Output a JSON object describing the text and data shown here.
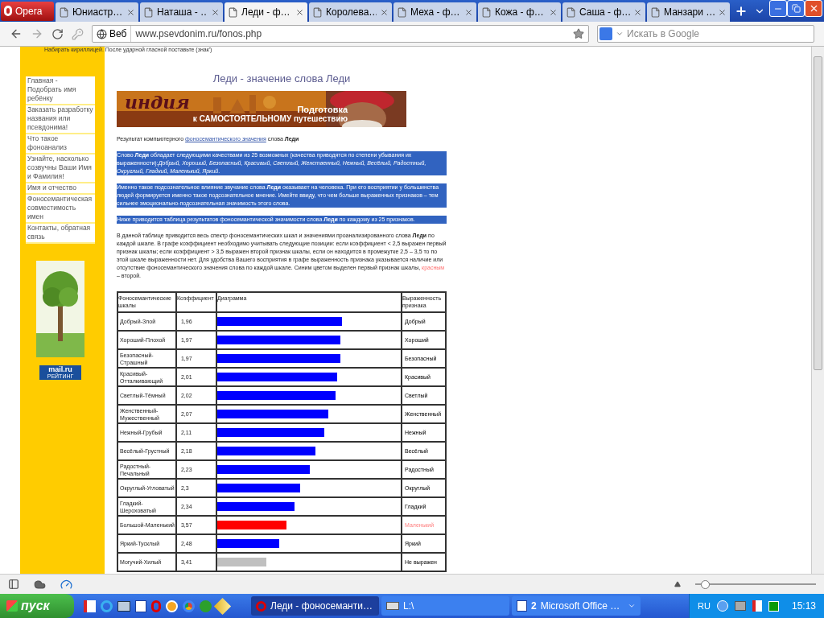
{
  "browser": {
    "menu_button": "Opera",
    "tabs": [
      {
        "label": "Юниастр…",
        "selected": false
      },
      {
        "label": "Наташа - …",
        "selected": false
      },
      {
        "label": "Леди - ф…",
        "selected": true
      },
      {
        "label": "Королева…",
        "selected": false
      },
      {
        "label": "Меха - ф…",
        "selected": false
      },
      {
        "label": "Кожа - ф…",
        "selected": false
      },
      {
        "label": "Саша - ф…",
        "selected": false
      },
      {
        "label": "Манзари …",
        "selected": false
      }
    ],
    "address": {
      "mode": "Веб",
      "url": "www.psevdonim.ru/fonos.php"
    },
    "search": {
      "placeholder": "Искать в Google"
    }
  },
  "page": {
    "top_strip": "Набирать кириллицей. После ударной гласной поставьте (знак')",
    "sidebar": [
      "Главная - Подобрать имя ребёнку",
      "Заказать разработку названия или псевдонима!",
      "Что такое фоноанализ",
      "Узнайте, насколько созвучны Ваши Имя и Фамилия!",
      "Имя и отчество",
      "Фоносемантическая совместимость имен",
      "Контакты, обратная связь"
    ],
    "counter": {
      "logo": "mail.ru",
      "caption": "РЕЙТИНГ"
    },
    "title": "Леди - значение слова Леди",
    "banner": {
      "headline": "индия",
      "line_1": "Подготовка",
      "line_2": "к САМОСТОЯТЕЛЬНОМУ путешествию"
    },
    "intro": {
      "before": "Результат компьютерного ",
      "link": "фоносемантического значения",
      "after": " слова **Леди**"
    },
    "highlighted_paragraphs": [
      "Слово **Леди** обладает следующими качествами из 25 возможных (качества приводятся по степени убывания их выраженности):*Добрый, Хороший, Безопасный, Красивый, Светлый, Женственный, Нежный, Весёлый, Радостный, Округлый, Гладкий, Маленький, Яркий*.",
      "Именно такое подсознательное влияние звучание слова **Леди** оказывает на человека. При его восприятии у большинства людей формируется именно такое подсознательное мнение. Имейте ввиду, что чем больше выраженных признаков – тем сильнее эмоционально-подсознательная значимость этого слова.",
      "Ниже приводится таблица результатов фоносемантической значимости слова **Леди** по каждому из 25 признаков."
    ],
    "explanation": {
      "text": "В данной таблице приводится весь спектр фоносемантических шкал и значениями проанализированного слова **Леди** по каждой шкале. В графе коэффициент необходимо учитывать следующие позиции: если коэффициент < 2,5 выражен первый признак шкалы; если коэффициент > 3,5 выражен второй признак шкалы, если он находится в промежутке 2,5 – 3,5 то по этой шкале выраженности нет. Для удобства Вашего восприятия в графе выраженность признака указывается наличие или отсутствие фоносемантического значения слова по каждой шкале. Синим цветом выделен первый признак шкалы, ",
      "red_word": "красным",
      "tail": " – второй."
    },
    "table": {
      "columns": [
        "Фоносемантические шкалы",
        "Коэффициент",
        "Диаграмма",
        "Выраженность признака"
      ],
      "rows": [
        {
          "scale": "Добрый-Злой",
          "coefficient": "1,96",
          "level": 0.68,
          "kind": "first",
          "feature": "Добрый"
        },
        {
          "scale": "Хороший-Плохой",
          "coefficient": "1,97",
          "level": 0.673,
          "kind": "first",
          "feature": "Хороший"
        },
        {
          "scale": "Безопасный-Страшный",
          "coefficient": "1,97",
          "level": 0.673,
          "kind": "first",
          "feature": "Безопасный"
        },
        {
          "scale": "Красивый-Отталкивающий",
          "coefficient": "2,01",
          "level": 0.652,
          "kind": "first",
          "feature": "Красивый"
        },
        {
          "scale": "Светлый-Тёмный",
          "coefficient": "2,02",
          "level": 0.643,
          "kind": "first",
          "feature": "Светлый"
        },
        {
          "scale": "Женственный-Мужественный",
          "coefficient": "2,07",
          "level": 0.604,
          "kind": "first",
          "feature": "Женственный"
        },
        {
          "scale": "Нежный-Грубый",
          "coefficient": "2,11",
          "level": 0.583,
          "kind": "first",
          "feature": "Нежный"
        },
        {
          "scale": "Весёлый-Грустный",
          "coefficient": "2,18",
          "level": 0.535,
          "kind": "first",
          "feature": "Весёлый"
        },
        {
          "scale": "Радостный-Печальный",
          "coefficient": "2,23",
          "level": 0.505,
          "kind": "first",
          "feature": "Радостный"
        },
        {
          "scale": "Округлый-Угловатый",
          "coefficient": "2,3",
          "level": 0.453,
          "kind": "first",
          "feature": "Округлый"
        },
        {
          "scale": "Гладкий-Шероховатый",
          "coefficient": "2,34",
          "level": 0.423,
          "kind": "first",
          "feature": "Гладкий"
        },
        {
          "scale": "Большой-Маленький",
          "coefficient": "3,57",
          "level": 0.376,
          "kind": "second",
          "feature": "Маленький"
        },
        {
          "scale": "Яркий-Тусклый",
          "coefficient": "2,48",
          "level": 0.337,
          "kind": "first",
          "feature": "Яркий"
        },
        {
          "scale": "Могучий-Хилый",
          "coefficient": "3,41",
          "level": 0.268,
          "kind": "none",
          "feature": "Не выражен"
        }
      ]
    }
  },
  "status_bar": {
    "zoom": {
      "level": 0.08
    }
  },
  "taskbar": {
    "start": "пуск",
    "tasks": [
      {
        "kind": "opera",
        "label": "Леди - фоносеманти…",
        "selected": true
      },
      {
        "kind": "drive",
        "label": "L:\\",
        "selected": false
      },
      {
        "kind": "word",
        "count": "2",
        "label": "Microsoft Office …",
        "selected": false
      }
    ],
    "language": "RU",
    "clock": "15:13"
  }
}
